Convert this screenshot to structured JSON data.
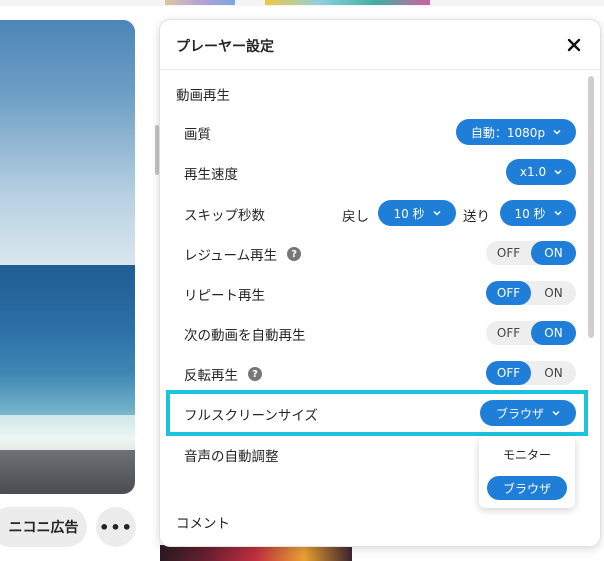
{
  "background": {
    "ad_label": "ニコニ広告",
    "more_label": "•••"
  },
  "panel": {
    "title": "プレーヤー設定",
    "section_playback": "動画再生",
    "section_comment": "コメント",
    "quality": {
      "label": "画質",
      "value": "自動：1080p"
    },
    "speed": {
      "label": "再生速度",
      "value": "x1.0"
    },
    "skip": {
      "label": "スキップ秒数",
      "back_label": "戻し",
      "back_value": "10 秒",
      "forward_label": "送り",
      "forward_value": "10 秒"
    },
    "resume": {
      "label": "レジューム再生",
      "off": "OFF",
      "on": "ON",
      "state": "on"
    },
    "repeat": {
      "label": "リピート再生",
      "off": "OFF",
      "on": "ON",
      "state": "off"
    },
    "autoplay": {
      "label": "次の動画を自動再生",
      "off": "OFF",
      "on": "ON",
      "state": "on"
    },
    "mirror": {
      "label": "反転再生",
      "off": "OFF",
      "on": "ON",
      "state": "off"
    },
    "fullscreen": {
      "label": "フルスクリーンサイズ",
      "value": "ブラウザ"
    },
    "volume": {
      "label": "音声の自動調整"
    },
    "fullscreen_options": [
      "モニター",
      "ブラウザ"
    ]
  },
  "colors": {
    "accent": "#1e7ed8",
    "highlight": "#1cc3de"
  }
}
